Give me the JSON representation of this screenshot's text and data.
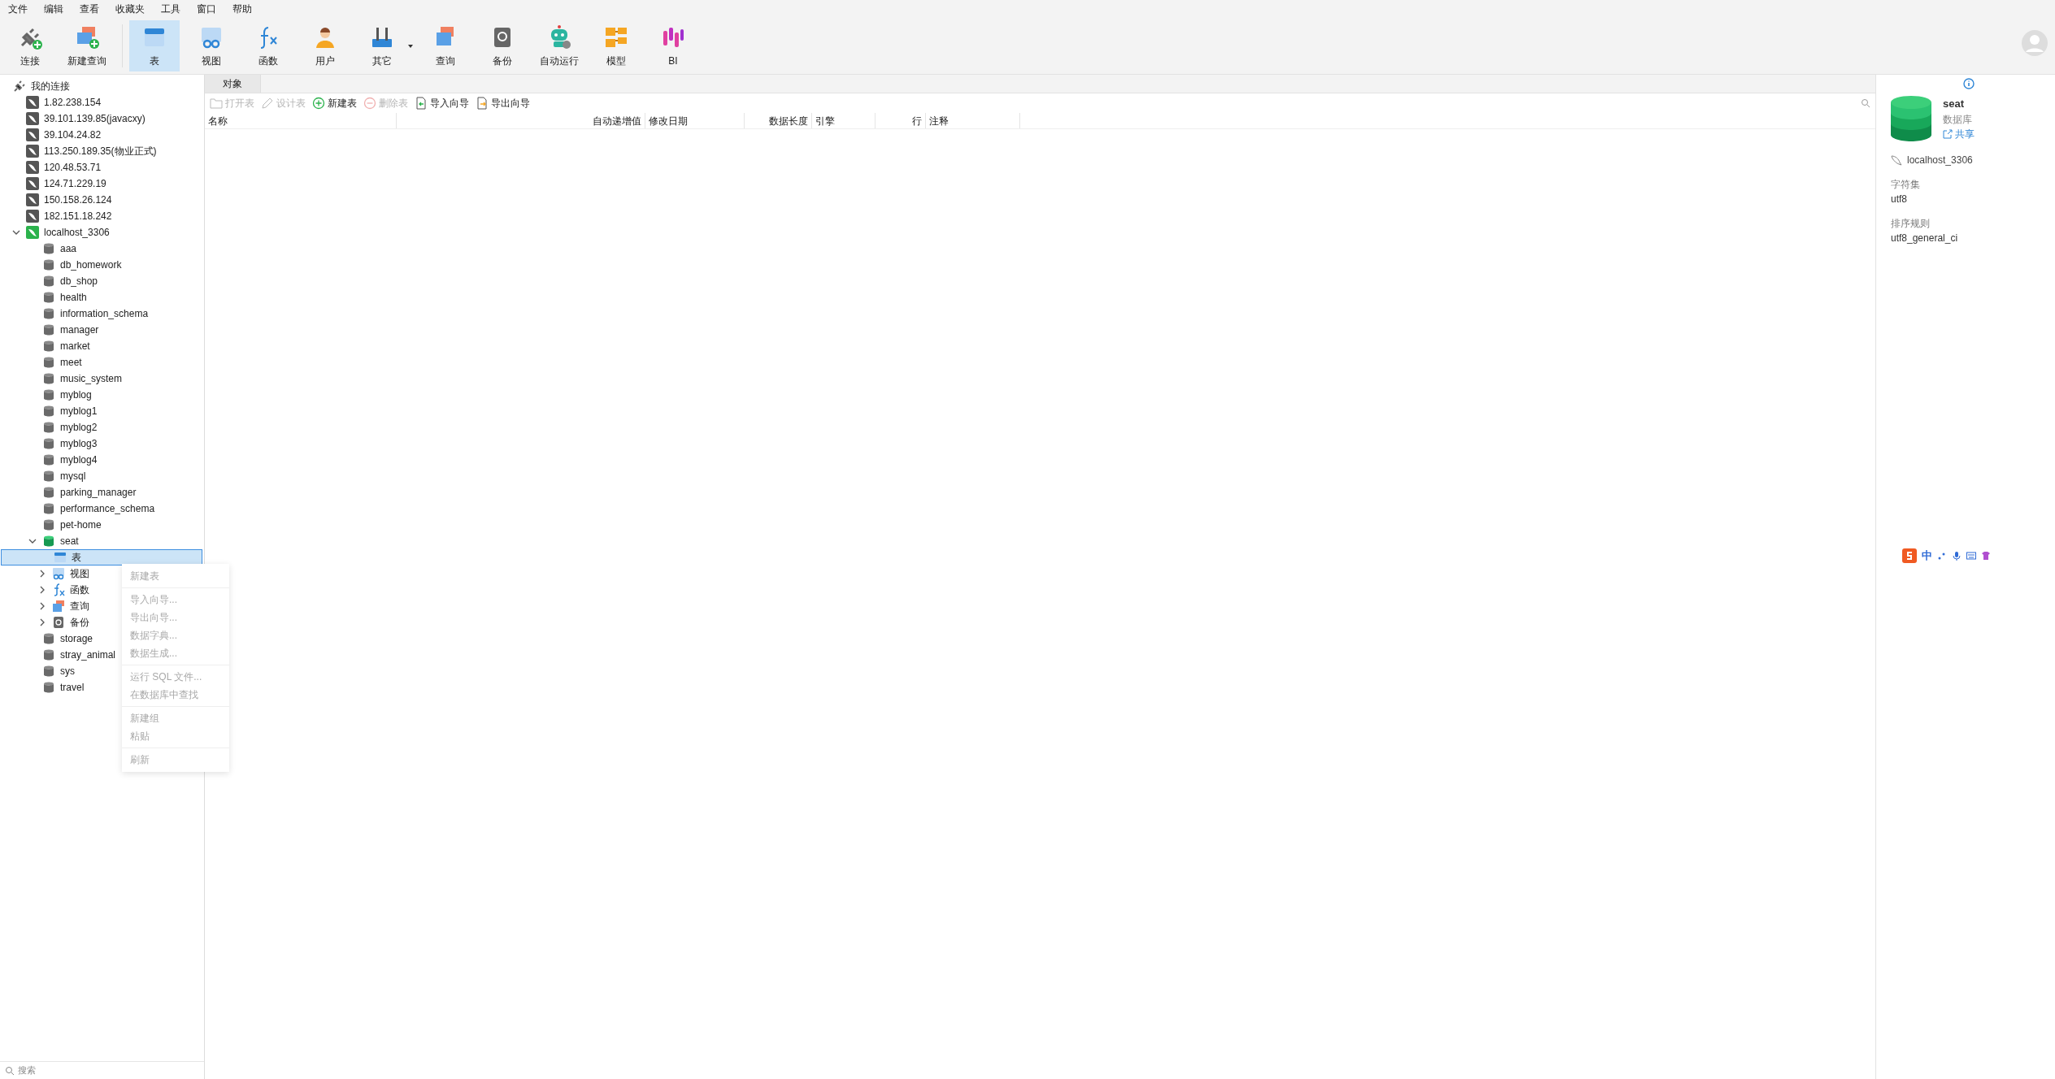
{
  "menu": [
    "文件",
    "编辑",
    "查看",
    "收藏夹",
    "工具",
    "窗口",
    "帮助"
  ],
  "toolbar": [
    {
      "kind": "connect",
      "label": "连接",
      "selected": false
    },
    {
      "kind": "newquery",
      "label": "新建查询",
      "selected": false
    },
    {
      "kind": "table",
      "label": "表",
      "selected": true
    },
    {
      "kind": "view",
      "label": "视图",
      "selected": false
    },
    {
      "kind": "function",
      "label": "函数",
      "selected": false
    },
    {
      "kind": "user",
      "label": "用户",
      "selected": false
    },
    {
      "kind": "other",
      "label": "其它",
      "selected": false
    },
    {
      "kind": "query",
      "label": "查询",
      "selected": false
    },
    {
      "kind": "backup",
      "label": "备份",
      "selected": false
    },
    {
      "kind": "robot",
      "label": "自动运行",
      "selected": false
    },
    {
      "kind": "model",
      "label": "模型",
      "selected": false
    },
    {
      "kind": "bi",
      "label": "BI",
      "selected": false
    }
  ],
  "sidebar": {
    "root": "我的连接",
    "connections": [
      {
        "label": "1.82.238.154",
        "active": false,
        "expanded": false
      },
      {
        "label": "39.101.139.85(javacxy)",
        "active": false,
        "expanded": false
      },
      {
        "label": "39.104.24.82",
        "active": false,
        "expanded": false
      },
      {
        "label": "113.250.189.35(物业正式)",
        "active": false,
        "expanded": false
      },
      {
        "label": "120.48.53.71",
        "active": false,
        "expanded": false
      },
      {
        "label": "124.71.229.19",
        "active": false,
        "expanded": false
      },
      {
        "label": "150.158.26.124",
        "active": false,
        "expanded": false
      },
      {
        "label": "182.151.18.242",
        "active": false,
        "expanded": false
      },
      {
        "label": "localhost_3306",
        "active": true,
        "expanded": true,
        "children": [
          {
            "label": "aaa",
            "open": false
          },
          {
            "label": "db_homework",
            "open": false
          },
          {
            "label": "db_shop",
            "open": false
          },
          {
            "label": "health",
            "open": false
          },
          {
            "label": "information_schema",
            "open": false
          },
          {
            "label": "manager",
            "open": false
          },
          {
            "label": "market",
            "open": false
          },
          {
            "label": "meet",
            "open": false
          },
          {
            "label": "music_system",
            "open": false
          },
          {
            "label": "myblog",
            "open": false
          },
          {
            "label": "myblog1",
            "open": false
          },
          {
            "label": "myblog2",
            "open": false
          },
          {
            "label": "myblog3",
            "open": false
          },
          {
            "label": "myblog4",
            "open": false
          },
          {
            "label": "mysql",
            "open": false
          },
          {
            "label": "parking_manager",
            "open": false
          },
          {
            "label": "performance_schema",
            "open": false
          },
          {
            "label": "pet-home",
            "open": false
          },
          {
            "label": "seat",
            "open": true,
            "children": [
              {
                "kind": "table",
                "label": "表",
                "selected": true
              },
              {
                "kind": "view",
                "label": "视图",
                "selected": false
              },
              {
                "kind": "function",
                "label": "函数",
                "selected": false
              },
              {
                "kind": "query",
                "label": "查询",
                "selected": false
              },
              {
                "kind": "backup",
                "label": "备份",
                "selected": false
              }
            ]
          },
          {
            "label": "storage",
            "open": false
          },
          {
            "label": "stray_animal",
            "open": false
          },
          {
            "label": "sys",
            "open": false
          },
          {
            "label": "travel",
            "open": false
          }
        ]
      }
    ],
    "search_placeholder": "搜索"
  },
  "context_menu": [
    [
      "新建表"
    ],
    [
      "导入向导...",
      "导出向导...",
      "数据字典...",
      "数据生成..."
    ],
    [
      "运行 SQL 文件...",
      "在数据库中查找"
    ],
    [
      "新建组",
      "粘贴"
    ],
    [
      "刷新"
    ]
  ],
  "tab": {
    "label": "对象",
    "selected": true
  },
  "object_toolbar": [
    {
      "kind": "open",
      "label": "打开表",
      "disabled": true
    },
    {
      "kind": "design",
      "label": "设计表",
      "disabled": true
    },
    {
      "kind": "new",
      "label": "新建表",
      "disabled": false
    },
    {
      "kind": "delete",
      "label": "删除表",
      "disabled": true
    },
    {
      "kind": "import",
      "label": "导入向导",
      "disabled": false
    },
    {
      "kind": "export",
      "label": "导出向导",
      "disabled": false
    }
  ],
  "columns": [
    "名称",
    "自动递增值",
    "修改日期",
    "数据长度",
    "引擎",
    "行",
    "注释"
  ],
  "info": {
    "name": "seat",
    "type": "数据库",
    "share": "共享",
    "connection": "localhost_3306",
    "fields": [
      {
        "label": "字符集",
        "value": "utf8"
      },
      {
        "label": "排序规则",
        "value": "utf8_general_ci"
      }
    ]
  },
  "ime": {
    "label": "中"
  }
}
